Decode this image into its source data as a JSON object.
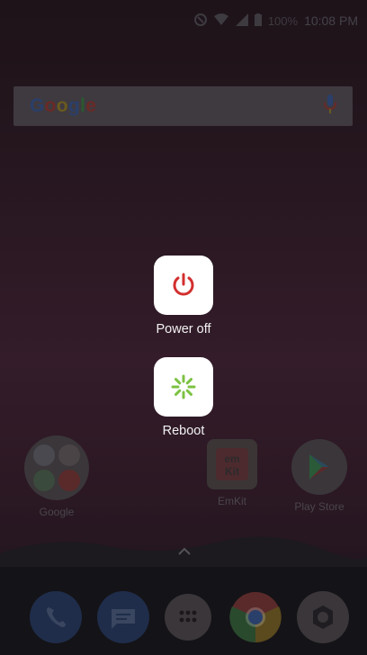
{
  "status_bar": {
    "battery": "100%",
    "time": "10:08 PM",
    "icons": [
      "nfc-icon",
      "wifi-icon",
      "signal-icon",
      "battery-icon"
    ]
  },
  "search": {
    "logo": "Google",
    "mic_icon": "mic-icon"
  },
  "home_apps": [
    {
      "label": "Google",
      "icon": "google-folder-icon"
    },
    {
      "label": "EmKit",
      "icon": "emkit-icon"
    },
    {
      "label": "Play Store",
      "icon": "play-store-icon"
    }
  ],
  "power_menu": {
    "power_off_label": "Power off",
    "power_off_icon": "power-icon",
    "power_off_color": "#d32f2f",
    "reboot_label": "Reboot",
    "reboot_icon": "reboot-icon",
    "reboot_color": "#7cc242"
  },
  "dock": [
    "phone-icon",
    "messages-icon",
    "app-drawer-icon",
    "chrome-icon",
    "camera-icon"
  ]
}
